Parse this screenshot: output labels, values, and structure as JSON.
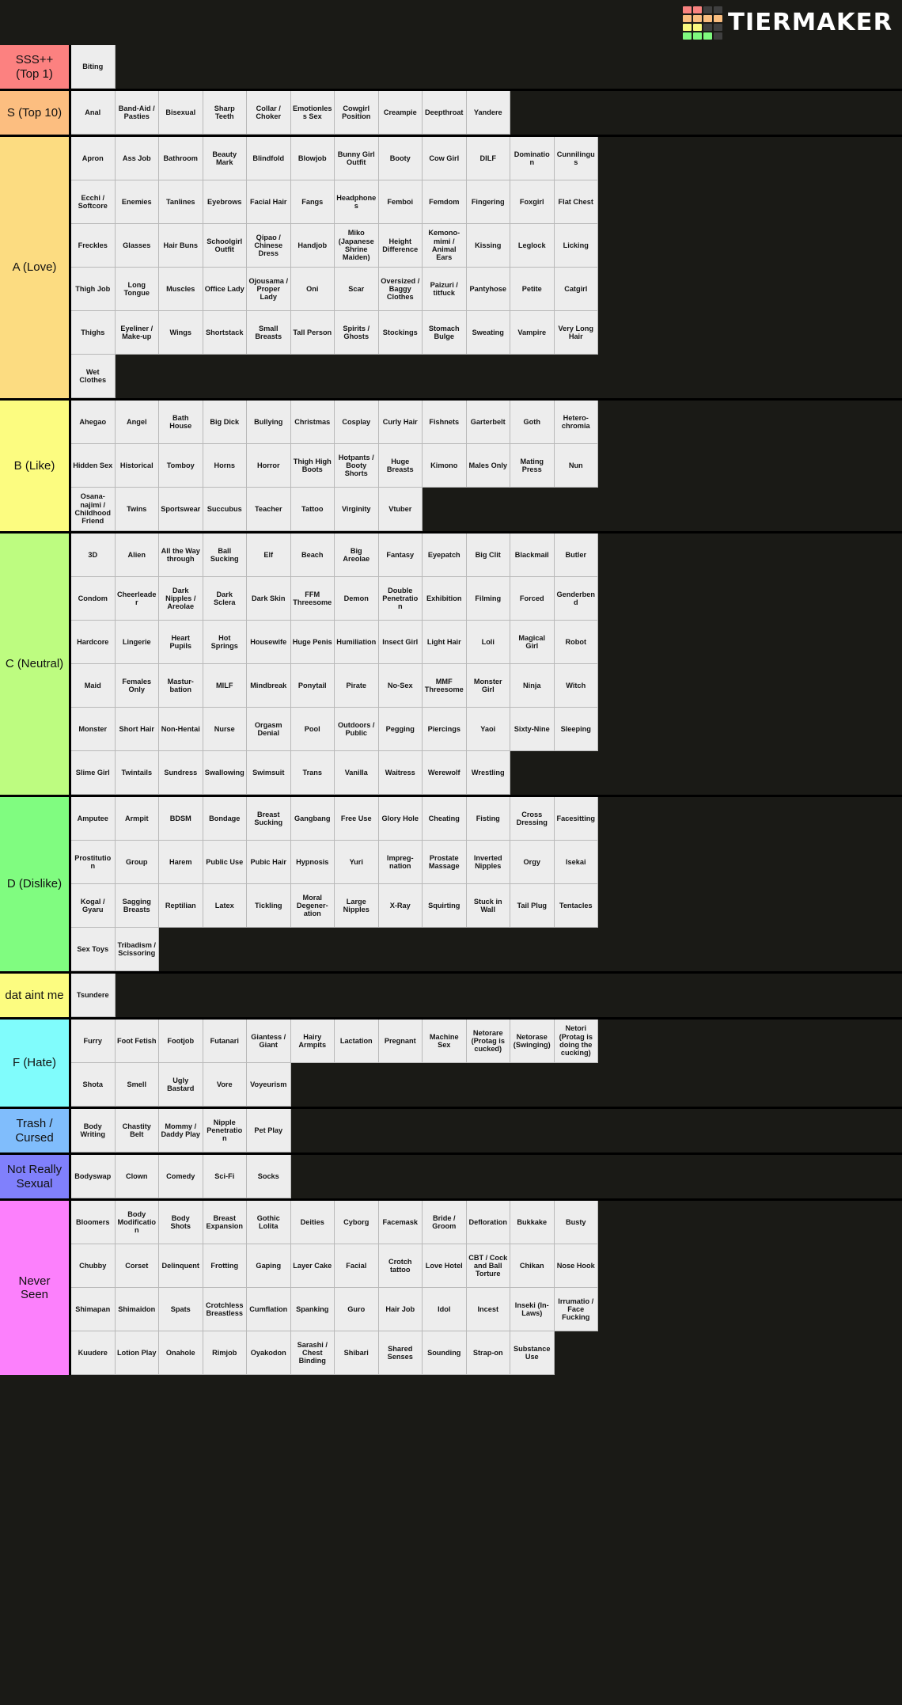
{
  "app": {
    "brand": "TIERMAKER",
    "logo_icon": "tiermaker-grid-logo",
    "logo_colors": [
      "#f98380",
      "#f98380",
      "#3f3f3f",
      "#3f3f3f",
      "#f9bd7f",
      "#f9bd7f",
      "#f9bd7f",
      "#f9bd7f",
      "#f9f97f",
      "#f9f97f",
      "#3f3f3f",
      "#3f3f3f",
      "#7ef97e",
      "#7ef97e",
      "#7ef97e",
      "#3f3f3f"
    ],
    "background": "#1a1a16"
  },
  "columns": 12,
  "tiers": [
    {
      "label": "SSS++ (Top 1)",
      "color": "#fc8180",
      "items": [
        "Biting"
      ]
    },
    {
      "label": "S (Top 10)",
      "color": "#fcbe80",
      "items": [
        "Anal",
        "Band-Aid / Pasties",
        "Bisexual",
        "Sharp Teeth",
        "Collar / Choker",
        "Emotionless Sex",
        "Cowgirl Position",
        "Creampie",
        "Deepthroat",
        "Yandere"
      ]
    },
    {
      "label": "A (Love)",
      "color": "#fcdc81",
      "items": [
        "Apron",
        "Ass Job",
        "Bathroom",
        "Beauty Mark",
        "Blindfold",
        "Blowjob",
        "Bunny Girl Outfit",
        "Booty",
        "Cow Girl",
        "DILF",
        "Domination",
        "Cunnilingus",
        "Ecchi / Softcore",
        "Enemies",
        "Tanlines",
        "Eyebrows",
        "Facial Hair",
        "Fangs",
        "Headphones",
        "Femboi",
        "Femdom",
        "Fingering",
        "Foxgirl",
        "Flat Chest",
        "Freckles",
        "Glasses",
        "Hair Buns",
        "Schoolgirl Outfit",
        "Qipao / Chinese Dress",
        "Handjob",
        "Miko (Japanese Shrine Maiden)",
        "Height Difference",
        "Kemono-mimi / Animal Ears",
        "Kissing",
        "Leglock",
        "Licking",
        "Thigh Job",
        "Long Tongue",
        "Muscles",
        "Office Lady",
        "Ojousama / Proper Lady",
        "Oni",
        "Scar",
        "Oversized / Baggy Clothes",
        "Paizuri / titfuck",
        "Pantyhose",
        "Petite",
        "Catgirl",
        "Thighs",
        "Eyeliner / Make-up",
        "Wings",
        "Shortstack",
        "Small Breasts",
        "Tall Person",
        "Spirits / Ghosts",
        "Stockings",
        "Stomach Bulge",
        "Sweating",
        "Vampire",
        "Very Long Hair",
        "Wet Clothes"
      ]
    },
    {
      "label": "B (Like)",
      "color": "#fcfc80",
      "items": [
        "Ahegao",
        "Angel",
        "Bath House",
        "Big Dick",
        "Bullying",
        "Christmas",
        "Cosplay",
        "Curly Hair",
        "Fishnets",
        "Garterbelt",
        "Goth",
        "Hetero-chromia",
        "Hidden Sex",
        "Historical",
        "Tomboy",
        "Horns",
        "Horror",
        "Thigh High Boots",
        "Hotpants / Booty Shorts",
        "Huge Breasts",
        "Kimono",
        "Males Only",
        "Mating Press",
        "Nun",
        "Osana-najimi / Childhood Friend",
        "Twins",
        "Sportswear",
        "Succubus",
        "Teacher",
        "Tattoo",
        "Virginity",
        "Vtuber"
      ]
    },
    {
      "label": "C (Neutral)",
      "color": "#bdfc80",
      "items": [
        "3D",
        "Alien",
        "All the Way through",
        "Ball Sucking",
        "Elf",
        "Beach",
        "Big Areolae",
        "Fantasy",
        "Eyepatch",
        "Big Clit",
        "Blackmail",
        "Butler",
        "Condom",
        "Cheerleader",
        "Dark Nipples / Areolae",
        "Dark Sclera",
        "Dark Skin",
        "FFM Threesome",
        "Demon",
        "Double Penetration",
        "Exhibition",
        "Filming",
        "Forced",
        "Genderbend",
        "Hardcore",
        "Lingerie",
        "Heart Pupils",
        "Hot Springs",
        "Housewife",
        "Huge Penis",
        "Humiliation",
        "Insect Girl",
        "Light Hair",
        "Loli",
        "Magical Girl",
        "Robot",
        "Maid",
        "Females Only",
        "Mastur-bation",
        "MILF",
        "Mindbreak",
        "Ponytail",
        "Pirate",
        "No-Sex",
        "MMF Threesome",
        "Monster Girl",
        "Ninja",
        "Witch",
        "Monster",
        "Short Hair",
        "Non-Hentai",
        "Nurse",
        "Orgasm Denial",
        "Pool",
        "Outdoors / Public",
        "Pegging",
        "Piercings",
        "Yaoi",
        "Sixty-Nine",
        "Sleeping",
        "Slime Girl",
        "Twintails",
        "Sundress",
        "Swallowing",
        "Swimsuit",
        "Trans",
        "Vanilla",
        "Waitress",
        "Werewolf",
        "Wrestling"
      ]
    },
    {
      "label": "D (Dislike)",
      "color": "#80fc80",
      "items": [
        "Amputee",
        "Armpit",
        "BDSM",
        "Bondage",
        "Breast Sucking",
        "Gangbang",
        "Free Use",
        "Glory Hole",
        "Cheating",
        "Fisting",
        "Cross Dressing",
        "Facesitting",
        "Prostitution",
        "Group",
        "Harem",
        "Public Use",
        "Pubic Hair",
        "Hypnosis",
        "Yuri",
        "Impreg-nation",
        "Prostate Massage",
        "Inverted Nipples",
        "Orgy",
        "Isekai",
        "Kogal / Gyaru",
        "Sagging Breasts",
        "Reptilian",
        "Latex",
        "Tickling",
        "Moral Degener-ation",
        "Large Nipples",
        "X-Ray",
        "Squirting",
        "Stuck in Wall",
        "Tail Plug",
        "Tentacles",
        "Sex Toys",
        "Tribadism / Scissoring"
      ]
    },
    {
      "label": "dat aint me",
      "color": "#fcfc80",
      "items": [
        "Tsundere"
      ]
    },
    {
      "label": "F (Hate)",
      "color": "#80fcfc",
      "items": [
        "Furry",
        "Foot Fetish",
        "Footjob",
        "Futanari",
        "Giantess / Giant",
        "Hairy Armpits",
        "Lactation",
        "Pregnant",
        "Machine Sex",
        "Netorare (Protag is cucked)",
        "Netorase (Swinging)",
        "Netori (Protag is doing the cucking)",
        "Shota",
        "Smell",
        "Ugly Bastard",
        "Vore",
        "Voyeurism"
      ]
    },
    {
      "label": "Trash / Cursed",
      "color": "#80bdfc",
      "items": [
        "Body Writing",
        "Chastity Belt",
        "Mommy / Daddy Play",
        "Nipple Penetration",
        "Pet Play"
      ]
    },
    {
      "label": "Not Really Sexual",
      "color": "#8080fc",
      "items": [
        "Bodyswap",
        "Clown",
        "Comedy",
        "Sci-Fi",
        "Socks"
      ]
    },
    {
      "label": "Never Seen",
      "color": "#fc80fc",
      "items": [
        "Bloomers",
        "Body Modification",
        "Body Shots",
        "Breast Expansion",
        "Gothic Lolita",
        "Deities",
        "Cyborg",
        "Facemask",
        "Bride / Groom",
        "Defloration",
        "Bukkake",
        "Busty",
        "Chubby",
        "Corset",
        "Delinquent",
        "Frotting",
        "Gaping",
        "Layer Cake",
        "Facial",
        "Crotch tattoo",
        "Love Hotel",
        "CBT / Cock and Ball Torture",
        "Chikan",
        "Nose Hook",
        "Shimapan",
        "Shimaidon",
        "Spats",
        "Crotchless Breastless",
        "Cumflation",
        "Spanking",
        "Guro",
        "Hair Job",
        "Idol",
        "Incest",
        "Inseki (In-Laws)",
        "Irrumatio / Face Fucking",
        "Kuudere",
        "Lotion Play",
        "Onahole",
        "Rimjob",
        "Oyakodon",
        "Sarashi / Chest Binding",
        "Shibari",
        "Shared Senses",
        "Sounding",
        "Strap-on",
        "Substance Use"
      ]
    }
  ]
}
